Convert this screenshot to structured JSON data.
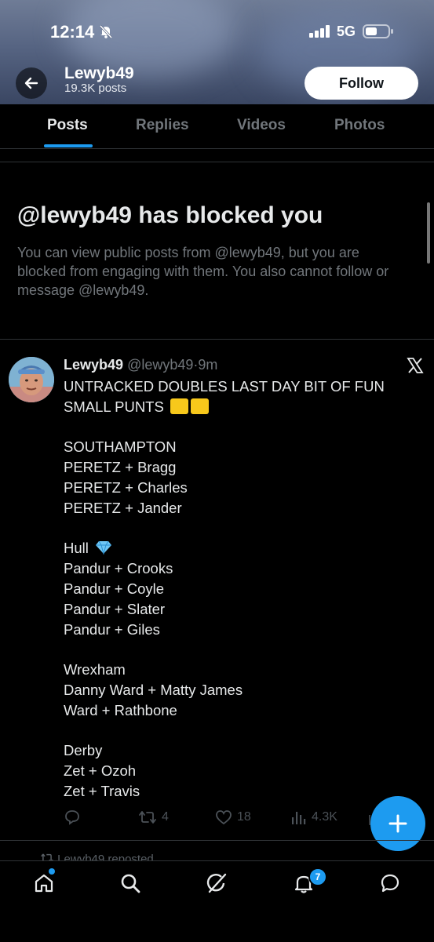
{
  "status_bar": {
    "time": "12:14",
    "network": "5G"
  },
  "profile": {
    "name": "Lewyb49",
    "posts_count": "19.3K posts",
    "follow_label": "Follow"
  },
  "tabs": [
    {
      "label": "Posts",
      "active": true
    },
    {
      "label": "Replies",
      "active": false
    },
    {
      "label": "Videos",
      "active": false
    },
    {
      "label": "Photos",
      "active": false
    }
  ],
  "blocked": {
    "title": "@lewyb49 has blocked you",
    "description": "You can view public posts from @lewyb49, but you are blocked from engaging with them. You also cannot follow or message @lewyb49."
  },
  "tweet": {
    "author_name": "Lewyb49",
    "handle": "@lewyb49",
    "time": "9m",
    "lines": [
      "UNTRACKED DOUBLES  LAST DAY  BIT OF FUN",
      "SMALL PUNTS",
      "",
      "SOUTHAMPTON",
      "PERETZ + Bragg",
      "PERETZ + Charles",
      "PERETZ + Jander",
      "",
      "Hull",
      "Pandur + Crooks",
      "Pandur + Coyle",
      "Pandur + Slater",
      "Pandur + Giles",
      "",
      "Wrexham",
      "Danny Ward + Matty James",
      "Ward + Rathbone",
      "",
      "Derby",
      "Zet + Ozoh",
      "Zet + Travis"
    ],
    "reply_count": "",
    "retweet_count": "4",
    "like_count": "18",
    "view_count": "4.3K"
  },
  "next_post_hint": "Lewyb49 reposted",
  "bottom_nav": {
    "notification_badge": "7"
  },
  "colors": {
    "accent": "#1d9bf0",
    "background": "#000000",
    "muted": "#71767b"
  }
}
